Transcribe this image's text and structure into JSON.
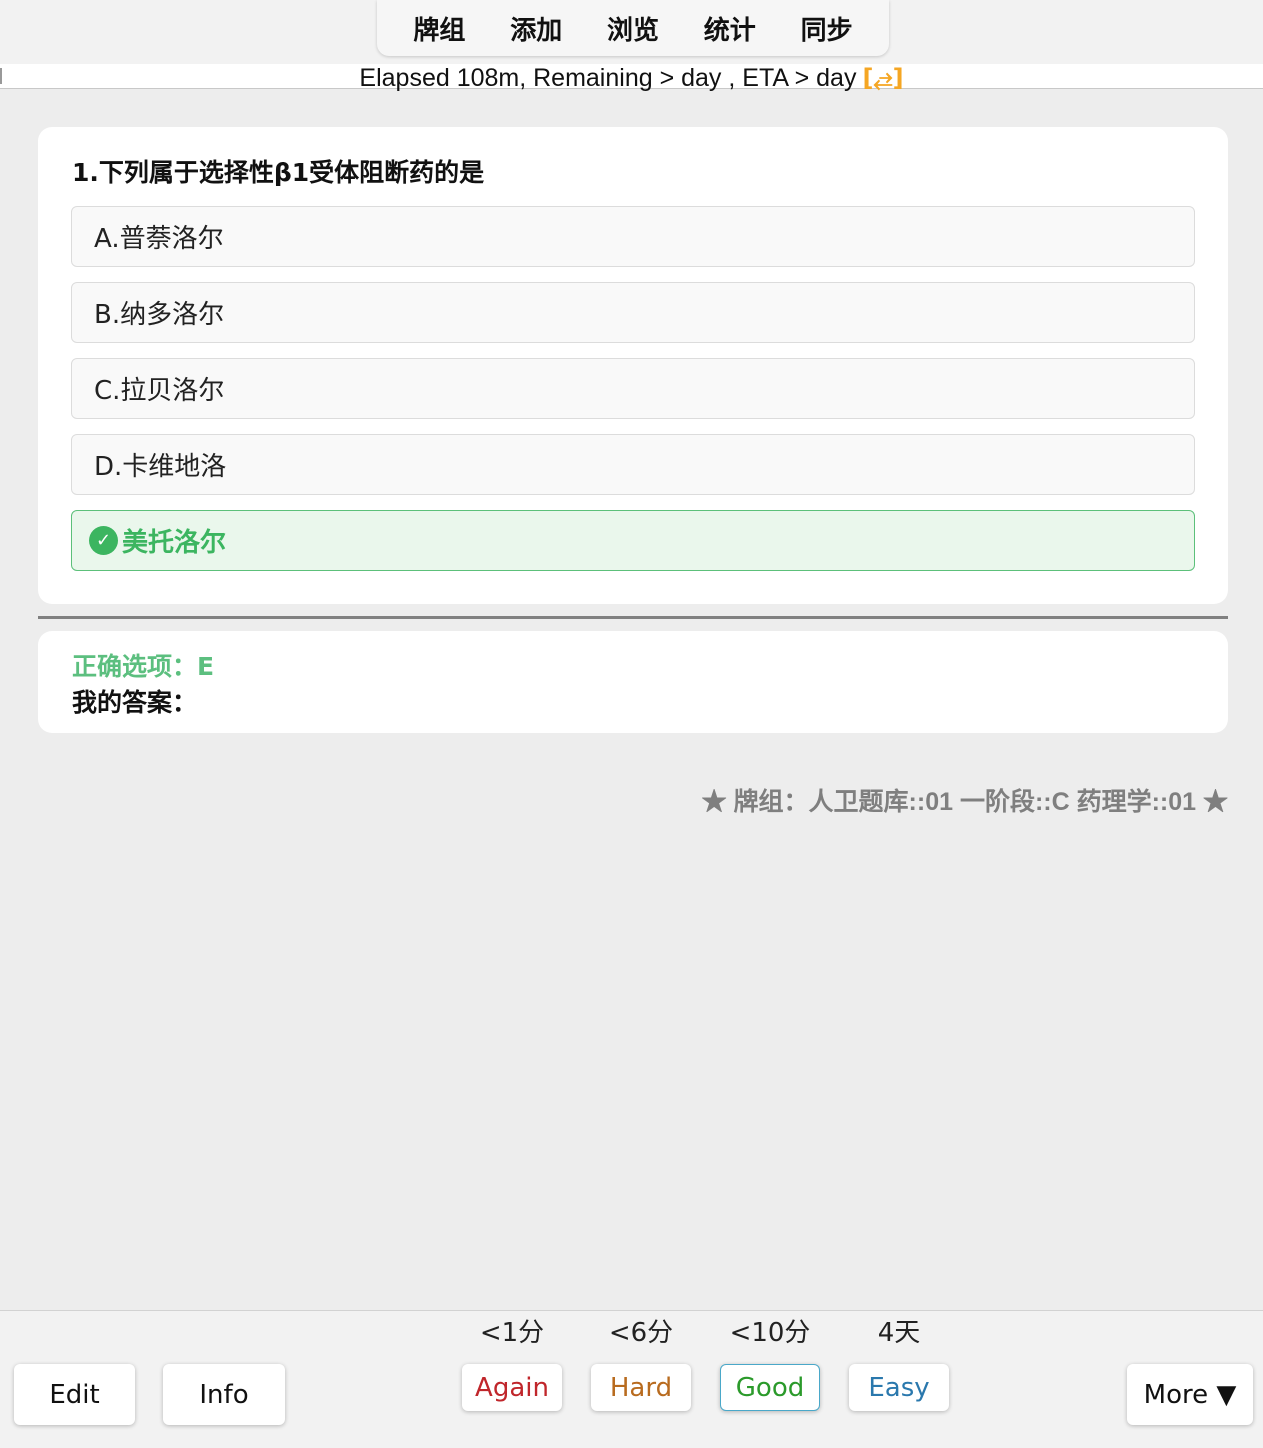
{
  "nav": {
    "items": [
      "牌组",
      "添加",
      "浏览",
      "统计",
      "同步"
    ]
  },
  "progress": {
    "text": "Elapsed 108m, Remaining > day , ETA > day",
    "sync_icon": "[⥄]"
  },
  "question": {
    "title": "1.下列属于选择性β1受体阻断药的是",
    "options": [
      "A.普萘洛尔",
      "B.纳多洛尔",
      "C.拉贝洛尔",
      "D.卡维地洛",
      "美托洛尔"
    ],
    "correct_index": 4,
    "check_icon": "✓"
  },
  "answer": {
    "correct_label": "正确选项：E",
    "my_answer_label": "我的答案："
  },
  "deck": {
    "label": "★ 牌组：人卫题库::01 一阶段::C 药理学::01 ★"
  },
  "bottom": {
    "edit": "Edit",
    "info": "Info",
    "more": "More ▼",
    "ease": [
      {
        "label": "Again",
        "time": "<1分",
        "color": "#c0262b"
      },
      {
        "label": "Hard",
        "time": "<6分",
        "color": "#b86b1f"
      },
      {
        "label": "Good",
        "time": "<10分",
        "color": "#2b9a2b"
      },
      {
        "label": "Easy",
        "time": "4天",
        "color": "#2a78ad"
      }
    ]
  }
}
